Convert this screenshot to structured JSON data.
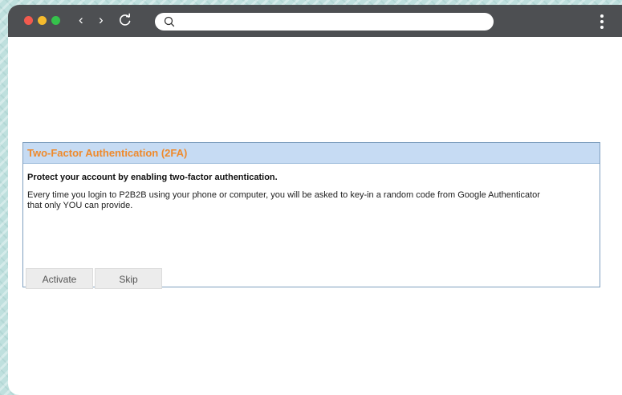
{
  "browser": {
    "traffic_lights": [
      "close",
      "minimize",
      "maximize"
    ],
    "colors": {
      "close": "#f25a4e",
      "minimize": "#f5bb2d",
      "maximize": "#35c24b",
      "toolbar": "#4d4f52"
    },
    "nav": {
      "back_icon": "chevron-left-icon",
      "forward_icon": "chevron-right-icon",
      "reload_icon": "reload-icon",
      "back_glyph": "‹",
      "forward_glyph": "›"
    },
    "address_bar": {
      "value": "",
      "placeholder": ""
    },
    "menu_icon": "kebab-menu-icon"
  },
  "dialog": {
    "title": "Two-Factor Authentication (2FA)",
    "subtitle": "Protect your account by enabling two-factor authentication.",
    "description": "Every time you login to P2B2B using your phone or computer, you will be asked to key-in a random code from Google Authenticator that only YOU can provide.",
    "buttons": {
      "activate": "Activate",
      "skip": "Skip"
    },
    "colors": {
      "title": "#ef8a2c",
      "header_bg": "#c6dbf3",
      "border": "#7f9fbf"
    }
  }
}
